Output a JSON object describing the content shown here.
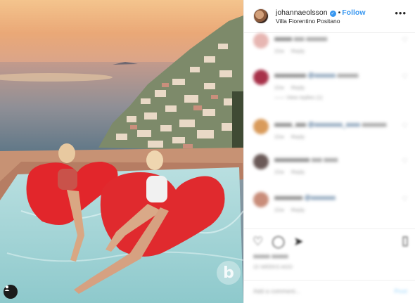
{
  "post": {
    "photo_alt": "",
    "watermark_letter": "b",
    "author": {
      "username": "johannaeolsson",
      "verified": true,
      "separator": "•",
      "follow_label": "Follow",
      "location": "Villa Fiorentino Positano"
    },
    "more_icon": "more-options-icon",
    "comments": [
      {
        "username": "aaaaa",
        "text": "aaa aaaaaa",
        "tag": "",
        "time": "22w",
        "reply": "Reply",
        "view_replies": "",
        "avatar_color": "#e7b6b2"
      },
      {
        "username": "aaaaaaaaa",
        "text": "aaaaaa",
        "tag": "@aaaaaa",
        "time": "22w",
        "reply": "Reply",
        "view_replies": "—— View replies (1)",
        "avatar_color": "#a8324a"
      },
      {
        "username": "aaaaa_aaa",
        "text": "aaaaaaa",
        "tag": "@aaaaaaaa_aaaa",
        "time": "22w",
        "reply": "Reply",
        "view_replies": "",
        "avatar_color": "#d99b5b"
      },
      {
        "username": "aaaaaaaaaa",
        "text": "aaa aaaa",
        "tag": "",
        "time": "22w",
        "reply": "Reply",
        "view_replies": "",
        "avatar_color": "#6b5a58"
      },
      {
        "username": "aaaaaaaa",
        "text": "",
        "tag": "@aaaaaaa",
        "time": "22w",
        "reply": "Reply",
        "view_replies": "",
        "avatar_color": "#c98d7a"
      }
    ],
    "actions": {
      "like_icon": "heart-icon",
      "comment_icon": "comment-icon",
      "share_icon": "share-icon",
      "save_icon": "bookmark-icon"
    },
    "likes_text": "aaaaa aaaaa",
    "time_text": "22 WEEKS AGO",
    "add_comment_placeholder": "Add a comment...",
    "post_label": "Post"
  }
}
